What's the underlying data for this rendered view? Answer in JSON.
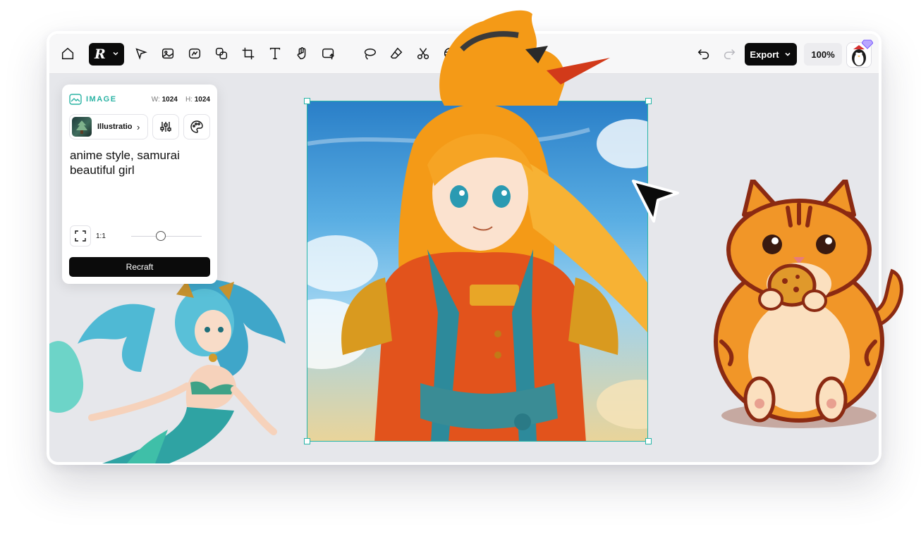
{
  "toolbar": {
    "brand_logo": "R",
    "tools": [
      "home-icon",
      "pointer-icon",
      "image-generate-icon",
      "vector-generate-icon",
      "layers-icon",
      "crop-frame-icon",
      "text-tool-icon",
      "hand-icon",
      "upload-image-icon",
      "lasso-icon",
      "eraser-icon",
      "scissors-icon",
      "style-mix-icon"
    ],
    "export_label": "Export",
    "zoom_label": "100%"
  },
  "panel": {
    "section_label": "IMAGE",
    "width_label": "W:",
    "width_value": "1024",
    "height_label": "H:",
    "height_value": "1024",
    "style_name": "Illustratio",
    "prompt": "anime style, samurai beautiful girl",
    "ratio_label": "1:1",
    "action_label": "Recraft"
  },
  "colors": {
    "accent": "#27b5a8",
    "dark": "#0b0b0b",
    "canvas": "#e6e7eb"
  }
}
